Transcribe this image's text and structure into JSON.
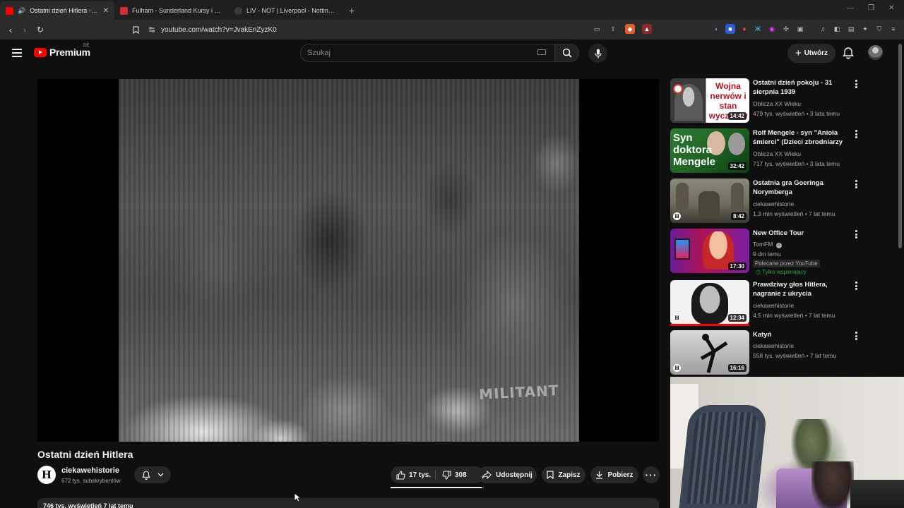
{
  "browser": {
    "tabs": [
      {
        "title": "Ostatni dzień Hitlera - YouTube",
        "favicon_color": "#ff0000",
        "active": true
      },
      {
        "title": "Fulham - Sunderland Kursy i Zakłady",
        "favicon_color": "#d32f2f",
        "active": false
      },
      {
        "title": "LIV - NOT | Liverpool - Nottingham F",
        "favicon_color": "#3a3a3a",
        "active": false
      }
    ],
    "url": "youtube.com/watch?v=JvakEnZyzK0"
  },
  "header": {
    "logo_text": "Premium",
    "region": "DE",
    "search_placeholder": "Szukaj",
    "create_label": "Utwórz"
  },
  "video": {
    "title": "Ostatni dzień Hitlera",
    "watermark": "MILITANT",
    "channel": {
      "name": "ciekawehistorie",
      "subs": "672 tys. subskrybentów",
      "logo_letter": "H"
    },
    "likes": "17 tys.",
    "like_ratio": 0.98,
    "dislikes": "308",
    "share_label": "Udostępnij",
    "save_label": "Zapisz",
    "download_label": "Pobierz",
    "description_meta": "746 tys. wyświetleń  7 lat temu"
  },
  "recommendations": [
    {
      "title": "Ostatni dzień pokoju - 31 sierpnia 1939",
      "channel": "Oblicza XX Wieku",
      "meta": "479 tys. wyświetleń • 3 lata temu",
      "duration": "14:42",
      "thumb_text": "Wojna nerwów i stan wyczekiw"
    },
    {
      "title": "Rolf Mengele - syn \"Anioła śmierci\" (Dzieci zbrodniarzy cz...",
      "channel": "Oblicza XX Wieku",
      "meta": "717 tys. wyświetleń • 3 lata temu",
      "duration": "32:42",
      "thumb_text": "Syn doktora Mengele"
    },
    {
      "title": "Ostatnia gra Goeringa Norymberga",
      "channel": "ciekawehistorie",
      "meta": "1,3 mln wyświetleń • 7 lat temu",
      "duration": "8:42",
      "thumb_text": ""
    },
    {
      "title": "New Office Tour",
      "channel": "TomFM",
      "meta": "9 dni temu",
      "duration": "17:30",
      "thumb_text": "",
      "badge": "Polecane przez YouTube",
      "members": "Tylko wspierający"
    },
    {
      "title": "Prawdziwy głos Hitlera, nagranie z ukrycia",
      "channel": "ciekawehistorie",
      "meta": "4,5 mln wyświetleń • 7 lat temu",
      "duration": "12:34",
      "thumb_text": ""
    },
    {
      "title": "Katyń",
      "channel": "ciekawehistorie",
      "meta": "558 tys. wyświetleń • 7 lat temu",
      "duration": "16:16",
      "thumb_text": ""
    }
  ]
}
